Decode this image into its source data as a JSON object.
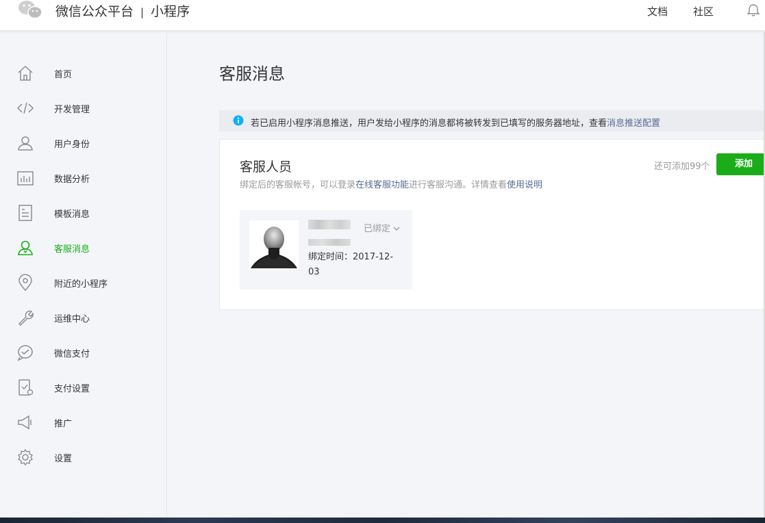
{
  "header": {
    "brand": "微信公众平台",
    "separator": "|",
    "product": "小程序",
    "links": [
      "文档",
      "社区"
    ]
  },
  "sidebar": {
    "items": [
      {
        "label": "首页",
        "icon": "home-icon"
      },
      {
        "label": "开发管理",
        "icon": "code-icon"
      },
      {
        "label": "用户身份",
        "icon": "user-icon"
      },
      {
        "label": "数据分析",
        "icon": "chart-icon"
      },
      {
        "label": "模板消息",
        "icon": "document-icon"
      },
      {
        "label": "客服消息",
        "icon": "customer-service-icon",
        "active": true
      },
      {
        "label": "附近的小程序",
        "icon": "location-icon"
      },
      {
        "label": "运维中心",
        "icon": "wrench-icon"
      },
      {
        "label": "微信支付",
        "icon": "wechat-pay-icon"
      },
      {
        "label": "支付设置",
        "icon": "pay-settings-icon"
      },
      {
        "label": "推广",
        "icon": "megaphone-icon"
      },
      {
        "label": "设置",
        "icon": "gear-icon"
      }
    ]
  },
  "main": {
    "title": "客服消息",
    "notice": {
      "text": "若已启用小程序消息推送，用户发给小程序的消息都将被转发到已填写的服务器地址，查看",
      "link": "消息推送配置"
    },
    "card": {
      "title": "客服人员",
      "desc_prefix": "绑定后的客服帐号，可以登录",
      "desc_link1": "在线客服功能",
      "desc_middle": "进行客服沟通。详情查看",
      "desc_link2": "使用说明",
      "remaining": "还可添加99个",
      "add_button": "添加"
    },
    "staff": {
      "status": "已绑定",
      "bind_time": "绑定时间：2017-12-03"
    }
  },
  "colors": {
    "accent": "#1aad19",
    "link": "#576b95",
    "background": "#f4f5f9",
    "notice_bg": "#ebecf0",
    "info_icon": "#10aeff"
  }
}
